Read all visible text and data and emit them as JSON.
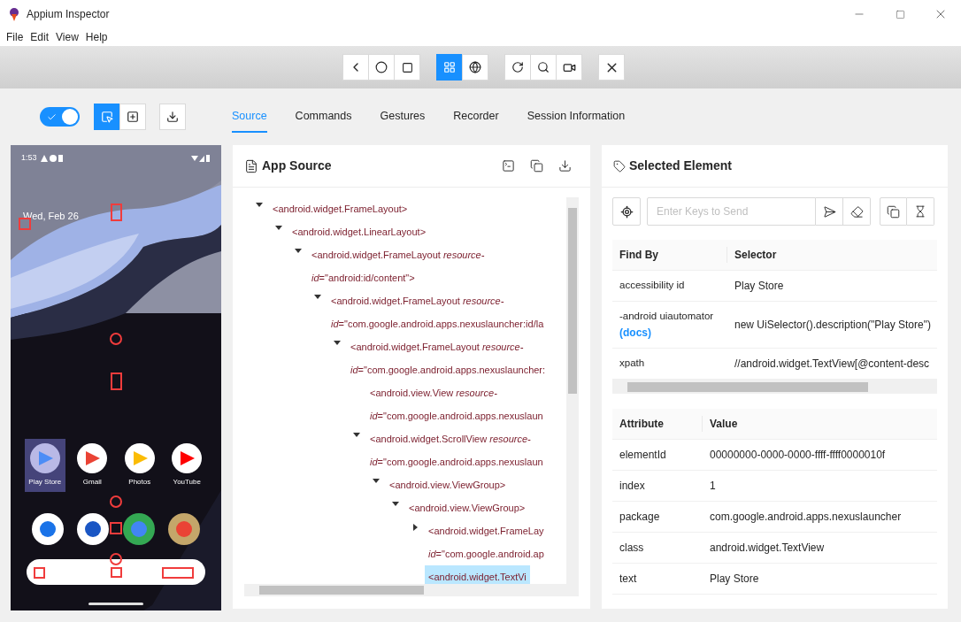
{
  "window": {
    "title": "Appium Inspector"
  },
  "menu": [
    "File",
    "Edit",
    "View",
    "Help"
  ],
  "context_buttons": [
    {
      "kind": "native",
      "selected": true
    },
    {
      "kind": "web",
      "selected": false
    }
  ],
  "controls": {
    "screenshot_toggle_on": true,
    "modes": [
      {
        "kind": "select",
        "selected": true
      },
      {
        "kind": "tap",
        "selected": false
      }
    ]
  },
  "tabs": [
    {
      "label": "Source",
      "selected": true
    },
    {
      "label": "Commands",
      "selected": false
    },
    {
      "label": "Gestures",
      "selected": false
    },
    {
      "label": "Recorder",
      "selected": false
    },
    {
      "label": "Session Information",
      "selected": false
    }
  ],
  "device": {
    "time": "1:53",
    "date": "Wed, Feb 26",
    "apps": [
      {
        "label": "Play Store",
        "selected": true
      },
      {
        "label": "Gmail",
        "selected": false
      },
      {
        "label": "Photos",
        "selected": false
      },
      {
        "label": "YouTube",
        "selected": false
      }
    ]
  },
  "app_source": {
    "title": "App Source",
    "nodes": [
      {
        "line1": "<android.widget.FrameLayout>",
        "expanded": true,
        "selected": false,
        "children": [
          {
            "line1": "<android.widget.LinearLayout>",
            "expanded": true,
            "selected": false,
            "children": [
              {
                "line1": "<android.widget.FrameLayout *resource-*",
                "line2": "*id*=\"android:id/content\">",
                "expanded": true,
                "selected": false,
                "children": [
                  {
                    "line1": "<android.widget.FrameLayout *resource-*",
                    "line2": "*id*=\"com.google.android.apps.nexuslauncher:id/la",
                    "expanded": true,
                    "selected": false,
                    "children": [
                      {
                        "line1": "<android.widget.FrameLayout *resource-*",
                        "line2": "*id*=\"com.google.android.apps.nexuslauncher:",
                        "expanded": true,
                        "selected": false,
                        "children": [
                          {
                            "line1": "<android.view.View *resource-*",
                            "line2": "*id*=\"com.google.android.apps.nexuslaun",
                            "selected": false
                          },
                          {
                            "line1": "<android.widget.ScrollView *resource-*",
                            "line2": "*id*=\"com.google.android.apps.nexuslaun",
                            "expanded": true,
                            "selected": false,
                            "children": [
                              {
                                "line1": "<android.view.ViewGroup>",
                                "expanded": true,
                                "selected": false,
                                "children": [
                                  {
                                    "line1": "<android.view.ViewGroup>",
                                    "expanded": true,
                                    "selected": false,
                                    "children": [
                                      {
                                        "line1": "<android.widget.FrameLay",
                                        "line2": "*id*=\"com.google.android.ap",
                                        "expanded": false,
                                        "selected": false
                                      },
                                      {
                                        "line1": "<android.widget.TextVi",
                                        "selected": true
                                      }
                                    ]
                                  }
                                ]
                              }
                            ]
                          }
                        ]
                      }
                    ]
                  }
                ]
              }
            ]
          }
        ]
      }
    ]
  },
  "selected_element": {
    "title": "Selected Element",
    "keys_field": {
      "placeholder": "Enter Keys to Send"
    },
    "find_by": {
      "columns": [
        "Find By",
        "Selector"
      ],
      "rows": [
        {
          "strategy": "accessibility id",
          "selector": "Play Store"
        },
        {
          "strategy": "-android uiautomator",
          "link": "(docs)",
          "selector": "new UiSelector().description(\"Play Store\")"
        },
        {
          "strategy": "xpath",
          "selector": "//android.widget.TextView[@content-desc"
        }
      ]
    },
    "attributes": {
      "columns": [
        "Attribute",
        "Value"
      ],
      "rows": [
        {
          "name": "elementId",
          "value": "00000000-0000-0000-ffff-ffff0000010f"
        },
        {
          "name": "index",
          "value": "1"
        },
        {
          "name": "package",
          "value": "com.google.android.apps.nexuslauncher"
        },
        {
          "name": "class",
          "value": "android.widget.TextView"
        },
        {
          "name": "text",
          "value": "Play Store"
        }
      ]
    }
  }
}
